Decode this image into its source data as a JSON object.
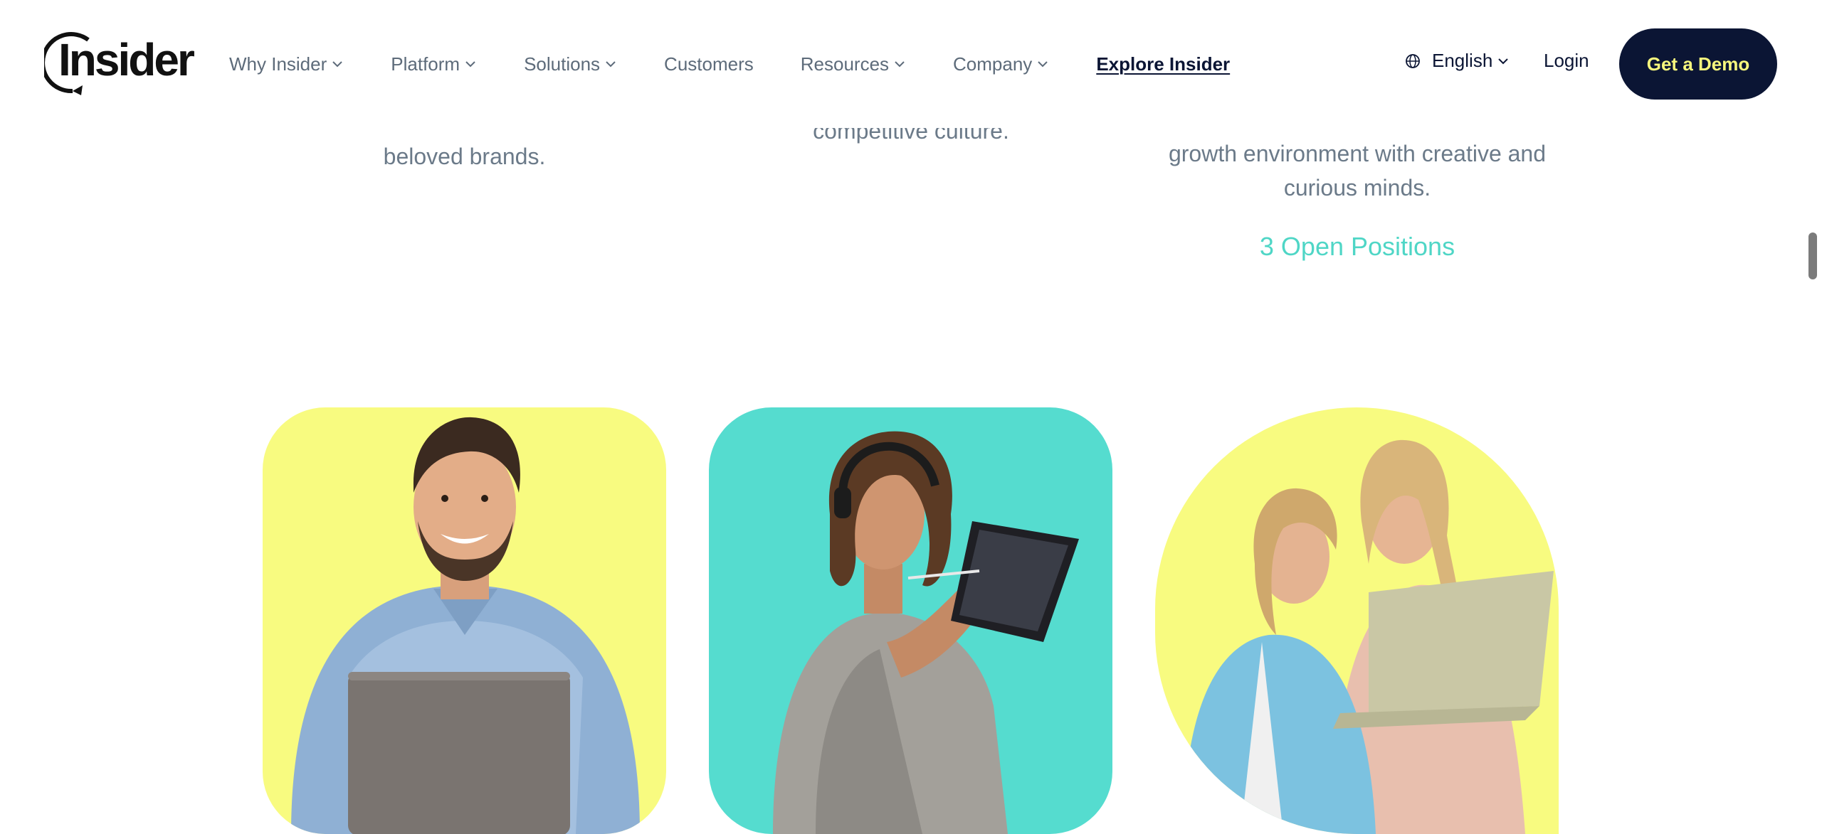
{
  "header": {
    "logo_text": "Insider",
    "nav": [
      {
        "label": "Why Insider",
        "has_dropdown": true
      },
      {
        "label": "Platform",
        "has_dropdown": true
      },
      {
        "label": "Solutions",
        "has_dropdown": true
      },
      {
        "label": "Customers",
        "has_dropdown": false
      },
      {
        "label": "Resources",
        "has_dropdown": true
      },
      {
        "label": "Company",
        "has_dropdown": true
      },
      {
        "label": "Explore Insider",
        "has_dropdown": false
      }
    ],
    "language": "English",
    "login": "Login",
    "cta": "Get a Demo"
  },
  "columns": [
    {
      "visible_text": "beloved brands."
    },
    {
      "visible_text": "competitive culture."
    },
    {
      "line1": "growth environment with creative and",
      "line2": "curious minds.",
      "link": "3 Open Positions"
    }
  ],
  "colors": {
    "navy": "#0b1534",
    "cta_text": "#f7f77d",
    "yellow": "#f8fb80",
    "teal": "#55dccf",
    "link_teal": "#4fd6c6",
    "body_gray": "#6b7a89",
    "nav_gray": "#5d6b7a"
  },
  "icons": [
    "chevron-down-icon",
    "globe-icon"
  ]
}
